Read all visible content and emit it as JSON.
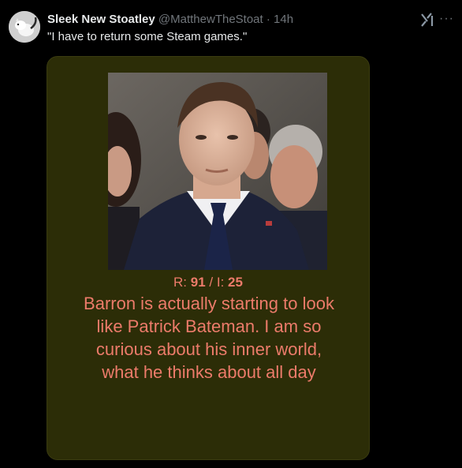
{
  "tweet": {
    "display_name": "Sleek New Stoatley",
    "handle": "@MatthewTheStoat",
    "separator": "·",
    "time": "14h",
    "text": "\"I have to return some Steam games.\"",
    "avatar_icon": "stoat-avatar-icon",
    "actions": {
      "grok_icon": "grok-icon",
      "more_label": "···"
    }
  },
  "media": {
    "photo_description_icon": "portrait-photo",
    "stats": {
      "r_prefix": "R: ",
      "r_value": "91",
      "sep": " / I: ",
      "i_value": "25"
    },
    "caption": "Barron is actually starting to look like Patrick Bateman. I am so curious about his inner world, what he thinks about all day"
  },
  "colors": {
    "background": "#000000",
    "card": "#2c2d07",
    "caption_text": "#ec7b6a",
    "name_text": "#e7e9ea",
    "muted_text": "#71767b"
  }
}
